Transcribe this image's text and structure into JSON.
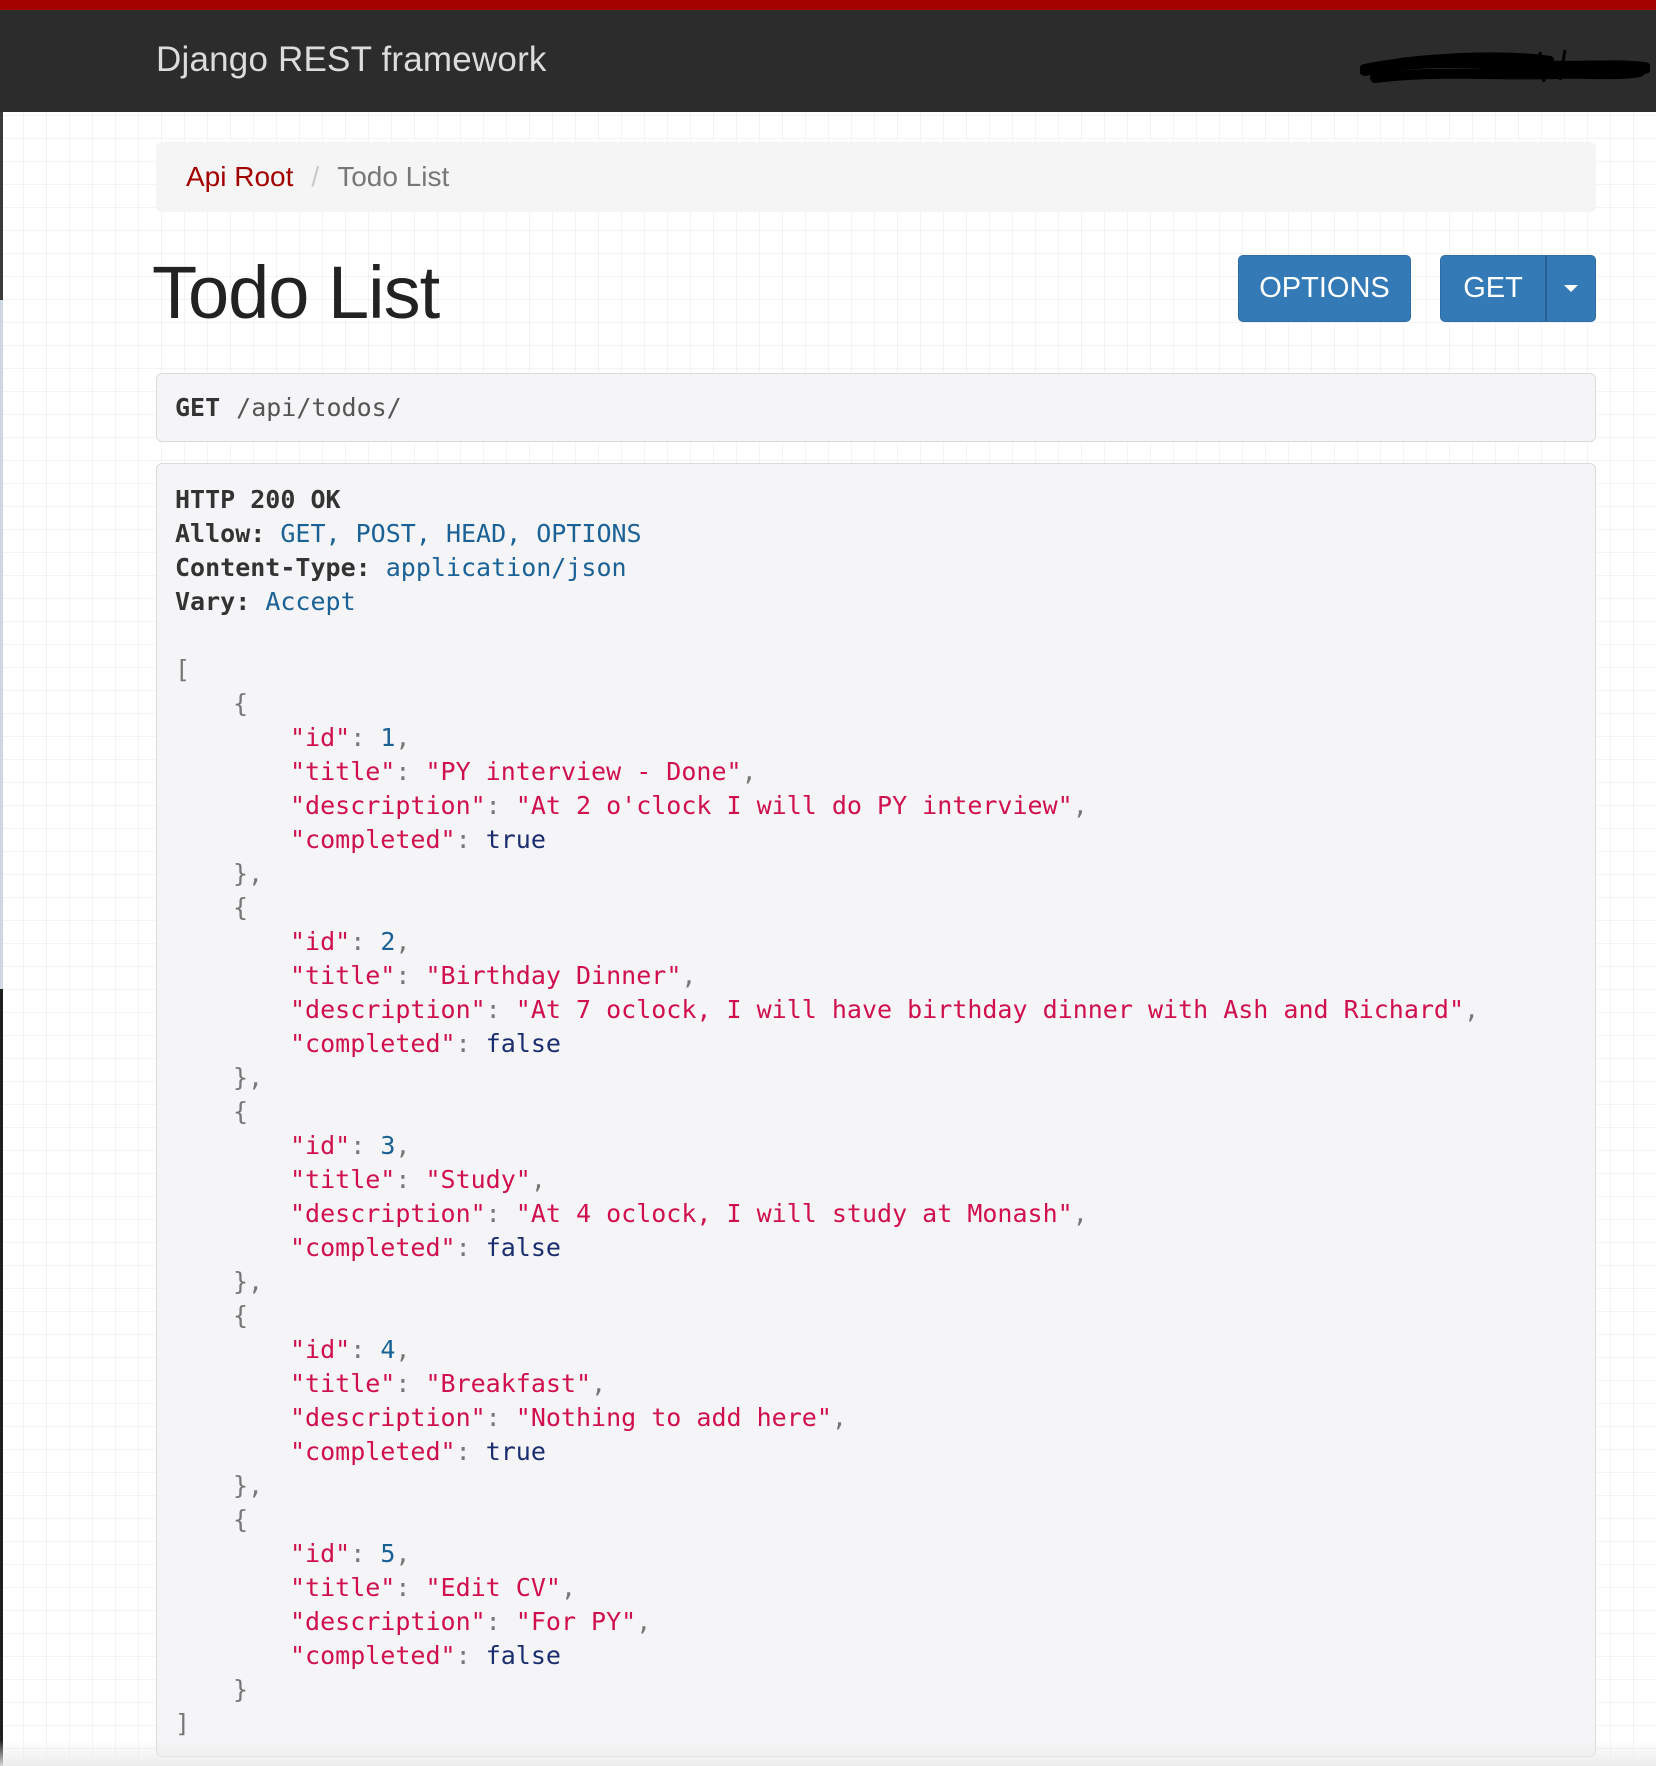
{
  "navbar": {
    "brand": "Django REST framework",
    "accent_color": "#a30000",
    "background": "#2c2c2c"
  },
  "breadcrumb": {
    "root_label": "Api Root",
    "separator": "/",
    "current_label": "Todo List"
  },
  "page": {
    "title": "Todo List"
  },
  "buttons": {
    "options_label": "OPTIONS",
    "get_label": "GET",
    "get_dropdown_icon": "caret-down-icon",
    "color": "#337ab7"
  },
  "request": {
    "method": "GET",
    "path": "/api/todos/"
  },
  "response": {
    "status": "HTTP 200 OK",
    "headers": [
      {
        "name": "Allow:",
        "value": "GET, POST, HEAD, OPTIONS"
      },
      {
        "name": "Content-Type:",
        "value": "application/json"
      },
      {
        "name": "Vary:",
        "value": "Accept"
      }
    ],
    "todos": [
      {
        "id": "1",
        "title": "PY interview - Done",
        "description": "At 2 o'clock I will do PY interview",
        "completed": "true"
      },
      {
        "id": "2",
        "title": "Birthday Dinner",
        "description": "At 7 oclock, I will have birthday dinner with Ash and Richard",
        "completed": "false"
      },
      {
        "id": "3",
        "title": "Study",
        "description": "At 4 oclock, I will study at Monash",
        "completed": "false"
      },
      {
        "id": "4",
        "title": "Breakfast",
        "description": "Nothing to add here",
        "completed": "true"
      },
      {
        "id": "5",
        "title": "Edit CV",
        "description": "For PY",
        "completed": "false"
      }
    ]
  }
}
